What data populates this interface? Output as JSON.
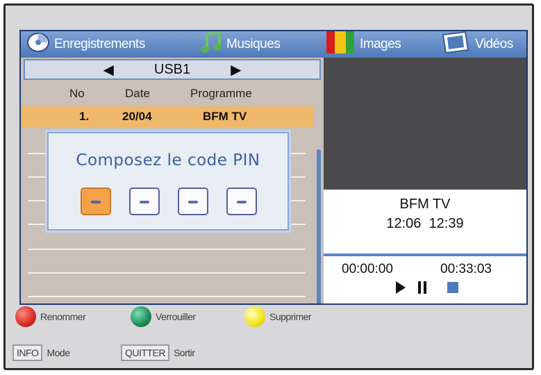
{
  "tabs": [
    {
      "label": "Enregistrements",
      "icon": "disc-icon"
    },
    {
      "label": "Musiques",
      "icon": "music-note-icon"
    },
    {
      "label": "Images",
      "icon": "images-icon"
    },
    {
      "label": "Vidéos",
      "icon": "video-icon"
    }
  ],
  "device": {
    "name": "USB1"
  },
  "columns": [
    "No",
    "Date",
    "Programme"
  ],
  "recordings": [
    {
      "no": "1.",
      "date": "20/04",
      "program": "BFM TV",
      "selected": true
    }
  ],
  "pin_dialog": {
    "title": "Composez le code PIN",
    "digits": [
      "–",
      "–",
      "–",
      "–"
    ],
    "active_index": 0
  },
  "now_playing": {
    "channel": "BFM TV",
    "start": "12:06",
    "end": "12:39",
    "elapsed": "00:00:00",
    "duration": "00:33:03"
  },
  "color_buttons": [
    {
      "label": "Renommer",
      "color": "#d62a22"
    },
    {
      "label": "Verrouiller",
      "color": "#1d8a5a"
    },
    {
      "label": "Supprimer",
      "color": "#f2e21e"
    }
  ],
  "keys": [
    {
      "key": "INFO",
      "label": "Mode"
    },
    {
      "key": "QUITTER",
      "label": "Sortir"
    }
  ],
  "colors": {
    "accent": "#4f79b8",
    "selection": "#f0b86b",
    "pin_active": "#f3a24a"
  }
}
